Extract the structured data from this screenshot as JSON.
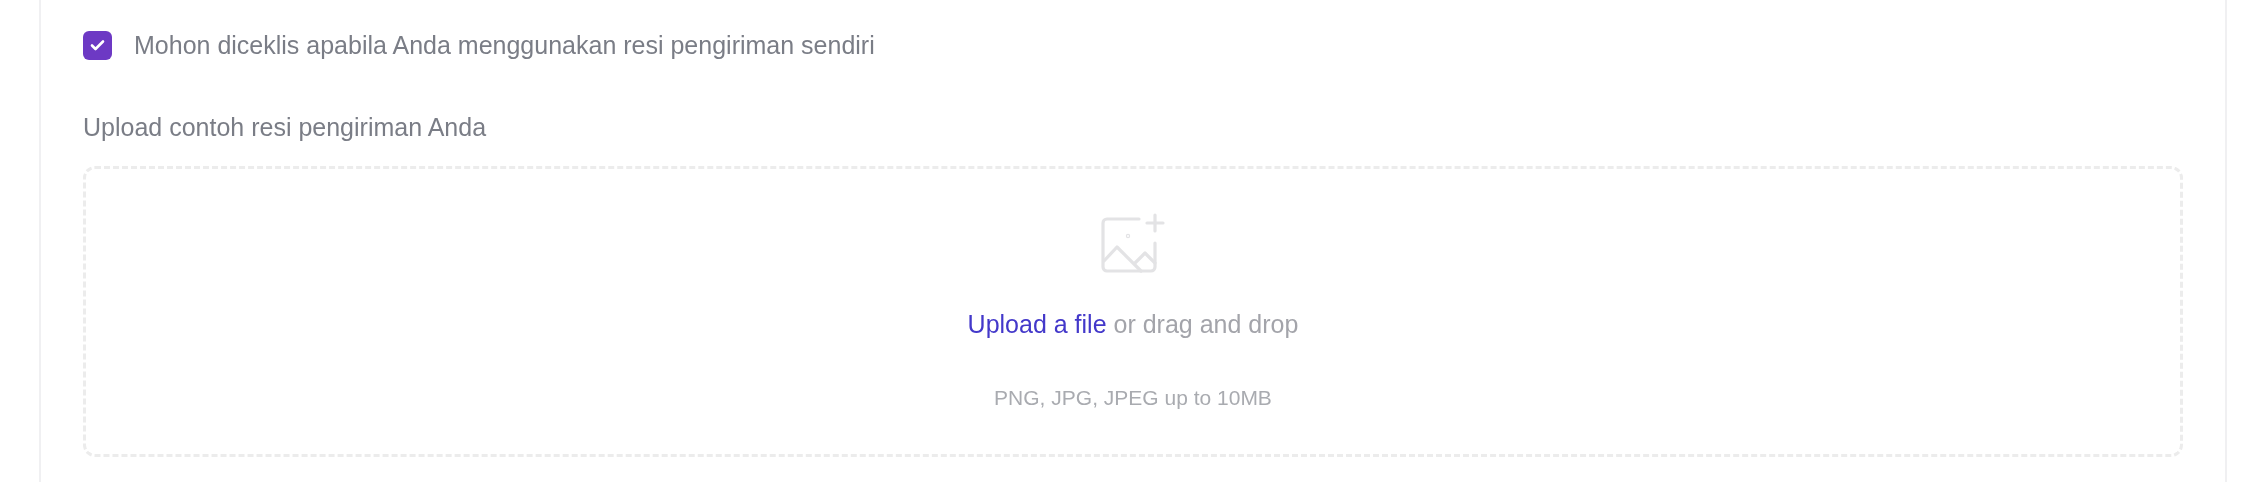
{
  "own_receipt": {
    "label": "Mohon diceklis apabila Anda menggunakan resi pengiriman sendiri",
    "checked": true
  },
  "upload": {
    "label": "Upload contoh resi pengiriman Anda",
    "link": "Upload a file",
    "text": "or drag and drop",
    "hint": "PNG, JPG, JPEG up to 10MB"
  }
}
